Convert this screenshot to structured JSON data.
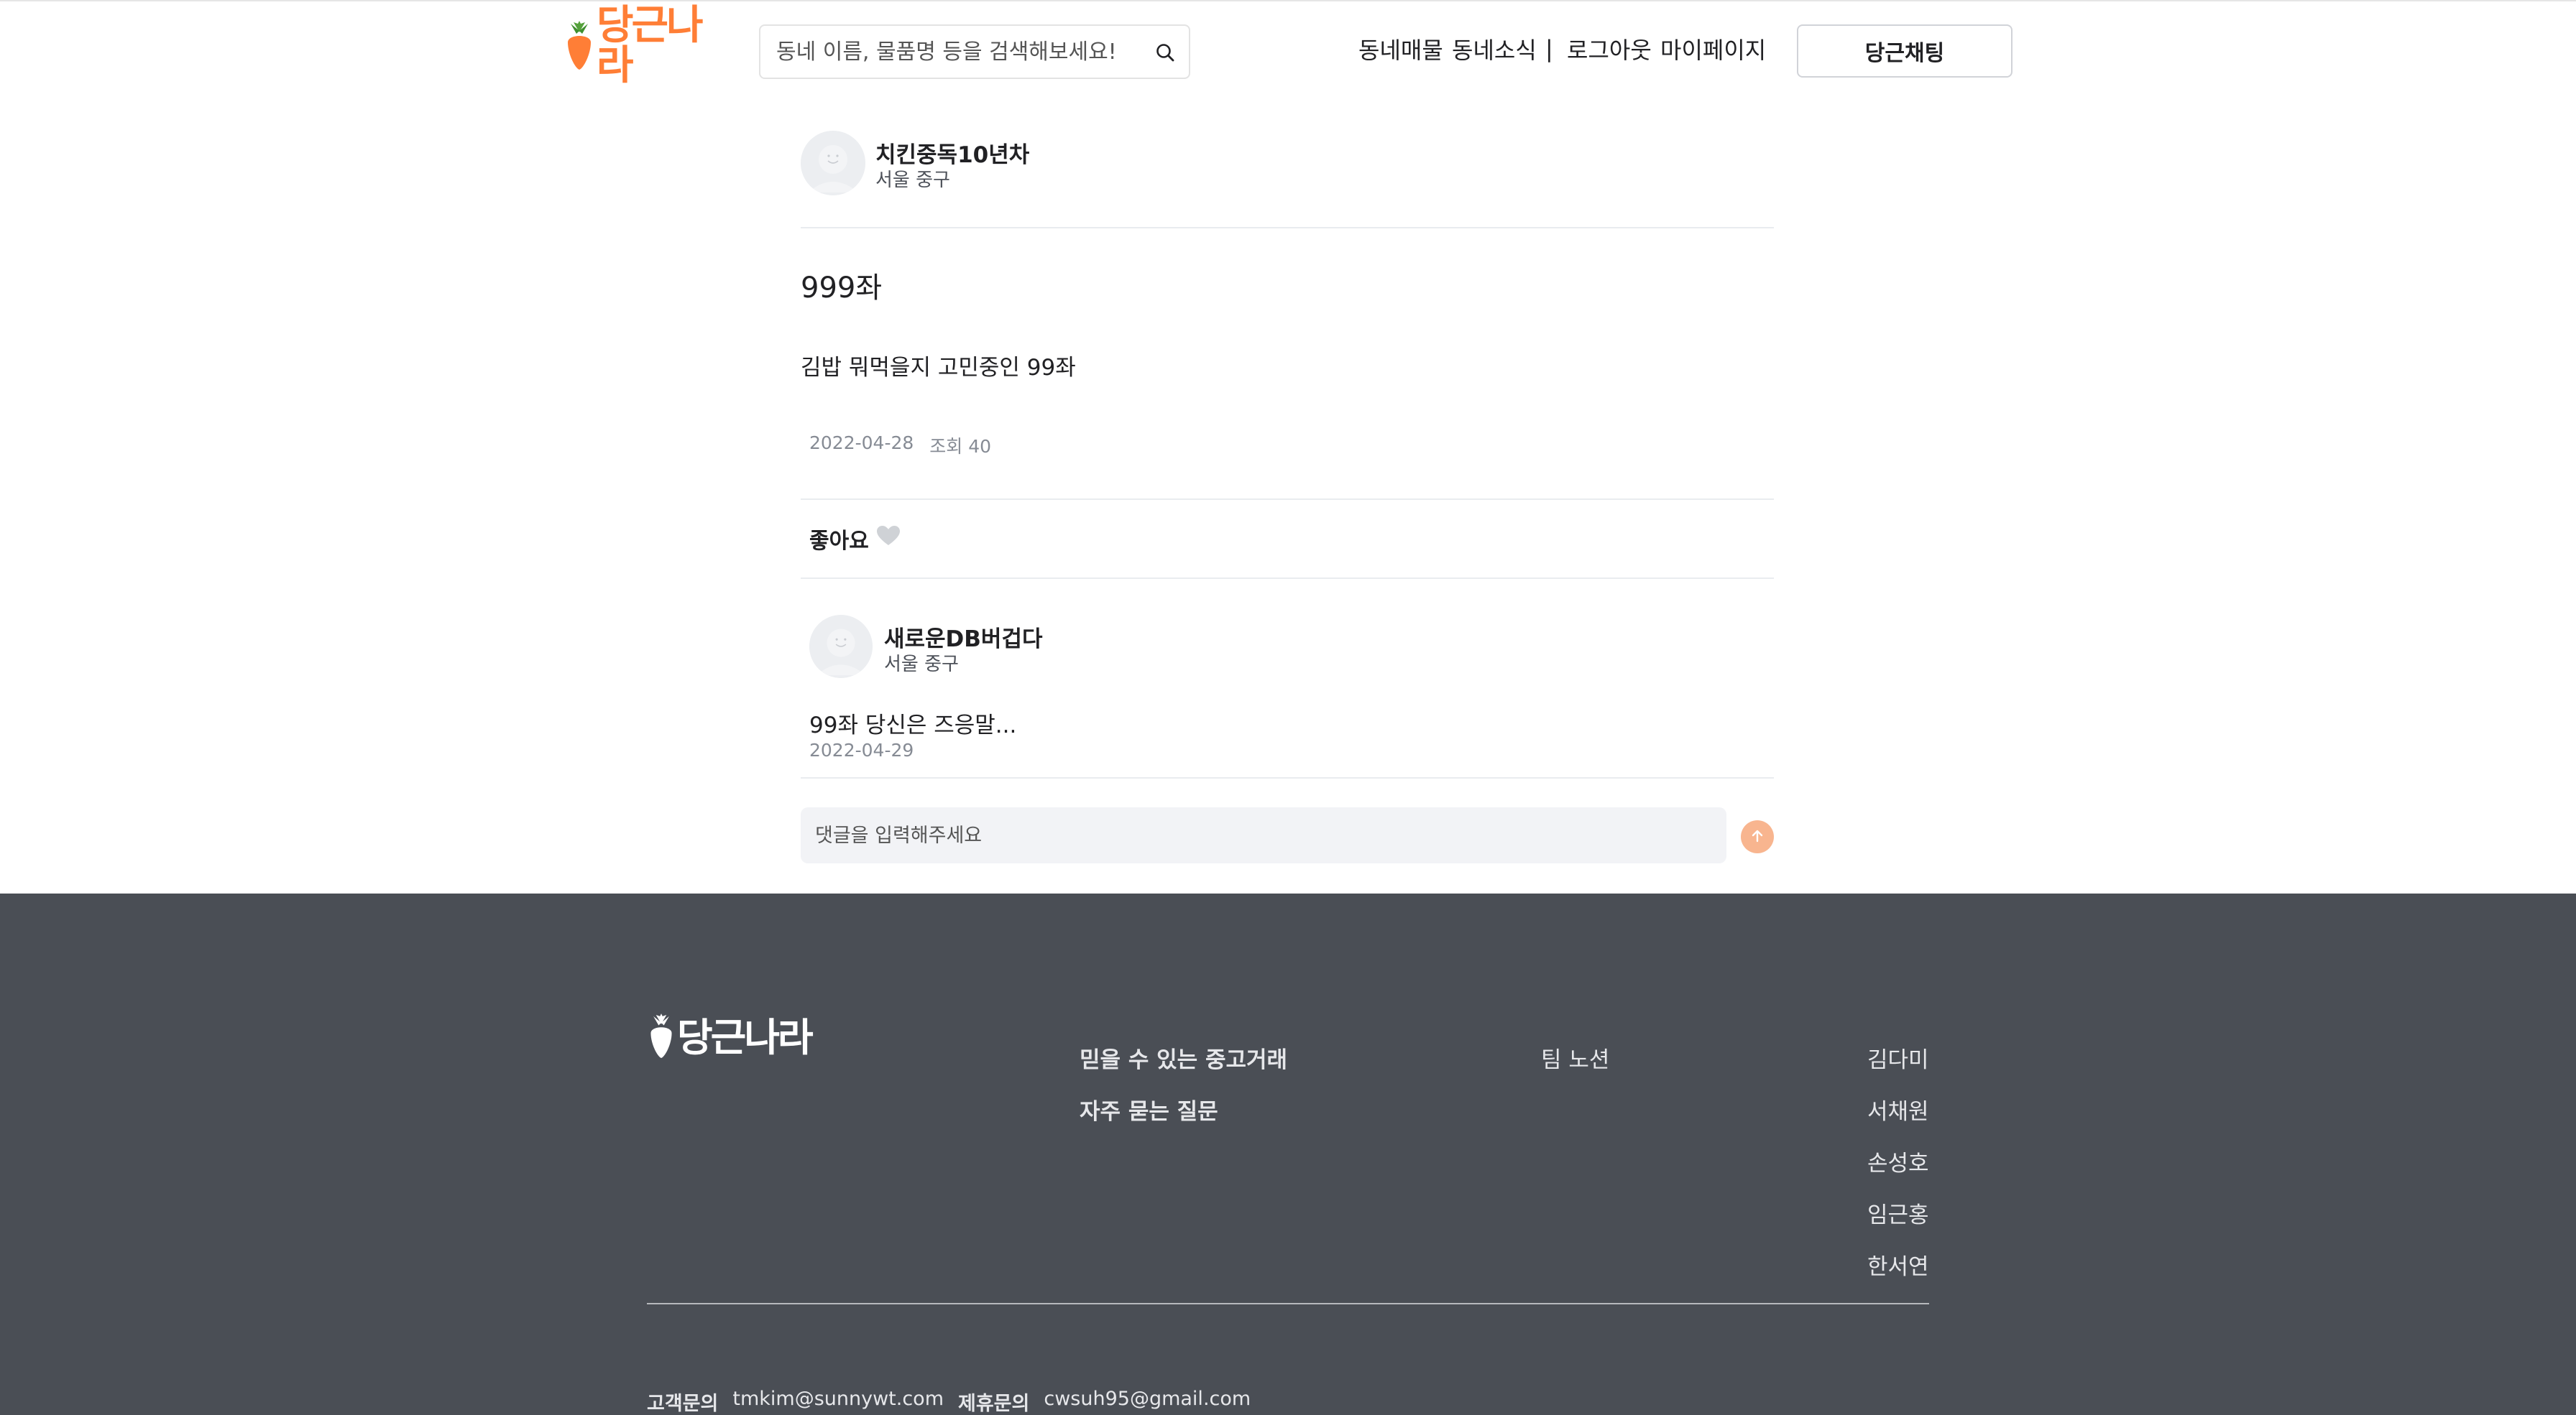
{
  "brand": {
    "name": "당근나라",
    "accent_color": "#ff7e36"
  },
  "header": {
    "search_placeholder": "동네 이름, 물품명 등을 검색해보세요!",
    "search_icon": "search-icon",
    "nav": {
      "market": "동네매물",
      "news": "동네소식",
      "separator": "|",
      "logout": "로그아웃",
      "mypage": "마이페이지"
    },
    "chat_button": "당근채팅"
  },
  "post": {
    "author": {
      "name": "치킨중독10년차",
      "region": "서울 중구"
    },
    "title": "999좌",
    "body": "김밥 뭐먹을지 고민중인 99좌",
    "date": "2022-04-28",
    "views": "조회 40",
    "like_label": "좋아요",
    "like_icon": "heart-icon"
  },
  "comments": [
    {
      "author": "새로운DB버겁다",
      "region": "서울 중구",
      "text": "99좌 당신은 즈응말...",
      "date": "2022-04-29"
    }
  ],
  "comment_form": {
    "placeholder": "댓글을 입력해주세요",
    "send_icon": "arrow-up-icon",
    "send_color": "#f8b58f"
  },
  "footer": {
    "logo": "당근나라",
    "links_bold": [
      "믿을 수 있는 중고거래",
      "자주 묻는 질문"
    ],
    "team_link": "팀 노션",
    "members": [
      "김다미",
      "서채원",
      "손성호",
      "임근홍",
      "한서연"
    ],
    "contact": {
      "customer_label": "고객문의",
      "customer_email": "tmkim@sunnywt.com",
      "partner_label": "제휴문의",
      "partner_email": "cwsuh95@gmail.com"
    },
    "background_color": "#4a4e55"
  }
}
